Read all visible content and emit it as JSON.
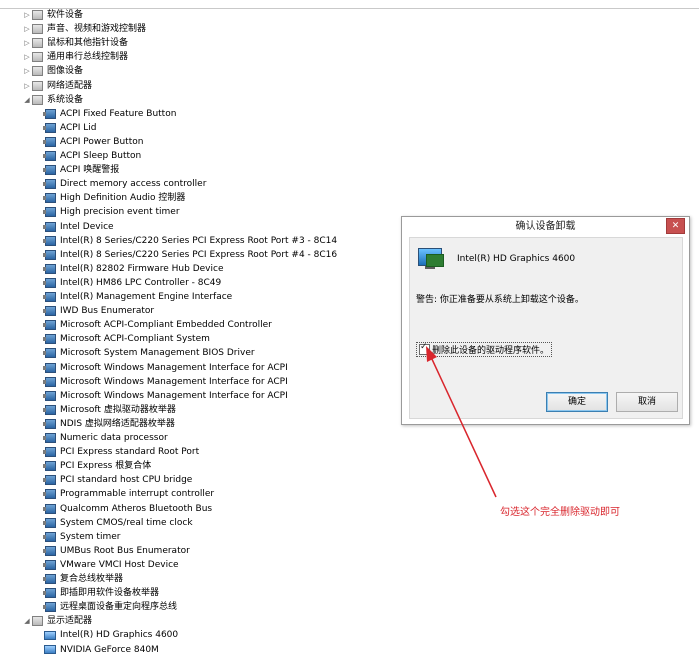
{
  "tree": {
    "items": [
      {
        "label": "软件设备",
        "type": "cat",
        "expanded": false
      },
      {
        "label": "声音、视频和游戏控制器",
        "type": "cat",
        "expanded": false
      },
      {
        "label": "鼠标和其他指针设备",
        "type": "cat",
        "expanded": false
      },
      {
        "label": "通用串行总线控制器",
        "type": "cat",
        "expanded": false
      },
      {
        "label": "图像设备",
        "type": "cat",
        "expanded": false
      },
      {
        "label": "网络适配器",
        "type": "cat",
        "expanded": false
      },
      {
        "label": "系统设备",
        "type": "cat",
        "expanded": true
      },
      {
        "label": "ACPI Fixed Feature Button",
        "type": "dev"
      },
      {
        "label": "ACPI Lid",
        "type": "dev"
      },
      {
        "label": "ACPI Power Button",
        "type": "dev"
      },
      {
        "label": "ACPI Sleep Button",
        "type": "dev"
      },
      {
        "label": "ACPI 唤醒警报",
        "type": "dev"
      },
      {
        "label": "Direct memory access controller",
        "type": "dev"
      },
      {
        "label": "High Definition Audio 控制器",
        "type": "dev"
      },
      {
        "label": "High precision event timer",
        "type": "dev"
      },
      {
        "label": "Intel Device",
        "type": "dev"
      },
      {
        "label": "Intel(R) 8 Series/C220 Series PCI Express Root Port #3 - 8C14",
        "type": "dev"
      },
      {
        "label": "Intel(R) 8 Series/C220 Series PCI Express Root Port #4 - 8C16",
        "type": "dev"
      },
      {
        "label": "Intel(R) 82802 Firmware Hub Device",
        "type": "dev"
      },
      {
        "label": "Intel(R) HM86 LPC Controller - 8C49",
        "type": "dev"
      },
      {
        "label": "Intel(R) Management Engine Interface",
        "type": "dev"
      },
      {
        "label": "IWD Bus Enumerator",
        "type": "dev"
      },
      {
        "label": "Microsoft ACPI-Compliant Embedded Controller",
        "type": "dev"
      },
      {
        "label": "Microsoft ACPI-Compliant System",
        "type": "dev"
      },
      {
        "label": "Microsoft System Management BIOS Driver",
        "type": "dev"
      },
      {
        "label": "Microsoft Windows Management Interface for ACPI",
        "type": "dev"
      },
      {
        "label": "Microsoft Windows Management Interface for ACPI",
        "type": "dev"
      },
      {
        "label": "Microsoft Windows Management Interface for ACPI",
        "type": "dev"
      },
      {
        "label": "Microsoft 虚拟驱动器枚举器",
        "type": "dev"
      },
      {
        "label": "NDIS 虚拟网络适配器枚举器",
        "type": "dev"
      },
      {
        "label": "Numeric data processor",
        "type": "dev"
      },
      {
        "label": "PCI Express standard Root Port",
        "type": "dev"
      },
      {
        "label": "PCI Express 根复合体",
        "type": "dev"
      },
      {
        "label": "PCI standard host CPU bridge",
        "type": "dev"
      },
      {
        "label": "Programmable interrupt controller",
        "type": "dev"
      },
      {
        "label": "Qualcomm Atheros Bluetooth Bus",
        "type": "dev"
      },
      {
        "label": "System CMOS/real time clock",
        "type": "dev"
      },
      {
        "label": "System timer",
        "type": "dev"
      },
      {
        "label": "UMBus Root Bus Enumerator",
        "type": "dev"
      },
      {
        "label": "VMware VMCI Host Device",
        "type": "dev"
      },
      {
        "label": "复合总线枚举器",
        "type": "dev"
      },
      {
        "label": "即插即用软件设备枚举器",
        "type": "dev"
      },
      {
        "label": "远程桌面设备重定向程序总线",
        "type": "dev"
      },
      {
        "label": "显示适配器",
        "type": "cat",
        "expanded": true
      },
      {
        "label": "Intel(R) HD Graphics 4600",
        "type": "disp"
      },
      {
        "label": "NVIDIA GeForce 840M",
        "type": "disp"
      }
    ]
  },
  "dialog": {
    "title": "确认设备卸载",
    "close_glyph": "✕",
    "device_name": "Intel(R) HD Graphics 4600",
    "warning": "警告: 你正准备要从系统上卸载这个设备。",
    "checkbox_label": "删除此设备的驱动程序软件。",
    "checkbox_checked": true,
    "ok_label": "确定",
    "cancel_label": "取消"
  },
  "annotation": {
    "text": "勾选这个完全删除驱动即可",
    "color": "#d9262d"
  }
}
